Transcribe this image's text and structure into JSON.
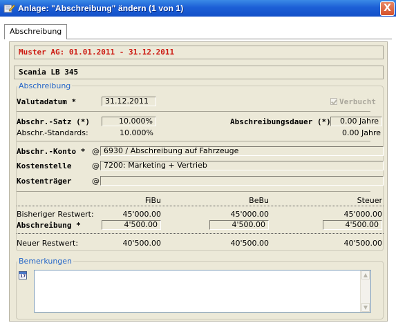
{
  "window": {
    "title": "Anlage: \"Abschreibung\" ändern (1 von 1)",
    "close_symbol": "X"
  },
  "tabs": [
    {
      "label": "Abschreibung"
    }
  ],
  "header": {
    "company_period": "Muster AG: 01.01.2011 - 31.12.2011",
    "asset_name": "Scania LB 345"
  },
  "abschreibung": {
    "legend": "Abschreibung",
    "valutadatum_label": "Valutadatum *",
    "valutadatum_value": "31.12.2011",
    "verbucht_label": "Verbucht",
    "verbucht_checked": true,
    "satz_label": "Abschr.-Satz (*)",
    "satz_value": "10.000%",
    "dauer_label": "Abschreibungsdauer (*)",
    "dauer_value": "0.00 Jahre",
    "standards_label": "Abschr.-Standards:",
    "standards_satz": "10.000%",
    "standards_dauer": "0.00 Jahre",
    "konto_label": "Abschr.-Konto *",
    "konto_value": "6930 / Abschreibung auf Fahrzeuge",
    "kostenstelle_label": "Kostenstelle",
    "kostenstelle_value": "7200: Marketing + Vertrieb",
    "kostentraeger_label": "Kostenträger",
    "kostentraeger_value": "",
    "at_symbol": "@"
  },
  "values_table": {
    "columns": [
      "FiBu",
      "BeBu",
      "Steuer"
    ],
    "bisheriger_label": "Bisheriger Restwert:",
    "bisheriger": [
      "45'000.00",
      "45'000.00",
      "45'000.00"
    ],
    "abschreibung_label": "Abschreibung *",
    "abschreibung": [
      "4'500.00",
      "4'500.00",
      "4'500.00"
    ],
    "neuer_label": "Neuer Restwert:",
    "neuer": [
      "40'500.00",
      "40'500.00",
      "40'500.00"
    ]
  },
  "bemerkungen": {
    "legend": "Bemerkungen",
    "calendar_day": "17",
    "text": ""
  },
  "colors": {
    "title_bar": "#1c5fd6",
    "panel": "#ece9d8",
    "company_text": "#cc1a12",
    "legend_text": "#2566c8"
  },
  "icons": {
    "window": "pencil-form-icon",
    "close": "close-icon",
    "calendar": "calendar-icon"
  }
}
